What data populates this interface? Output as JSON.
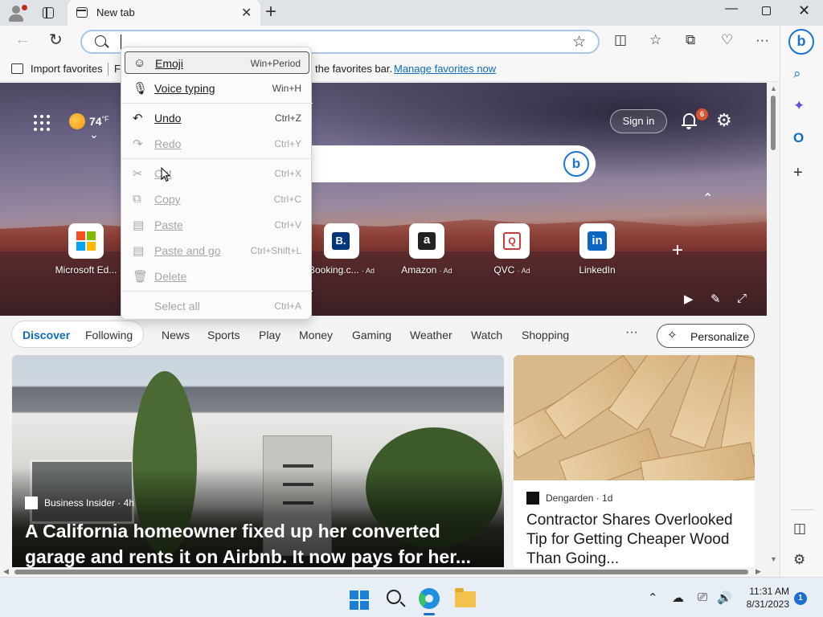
{
  "browser": {
    "tab_title": "New tab",
    "tab_close": "✕",
    "new_tab": "+",
    "window_min": "—",
    "window_close": "✕"
  },
  "toolbar": {
    "back": "←",
    "refresh": "↻",
    "address_value": "",
    "favorite_star": "☆",
    "split": "◫",
    "favorites": "☆",
    "collections": "⧉",
    "extensions": "♡",
    "more": "···"
  },
  "favbar": {
    "import_label": "Import favorites",
    "partial_item": "F",
    "message": "the favorites bar.",
    "manage_link": "Manage favorites now"
  },
  "sidebar": {
    "bing": "b",
    "search": "⌕",
    "copilot": "✦",
    "outlook": "O",
    "add": "+",
    "panel": "◫",
    "settings": "⚙"
  },
  "hero": {
    "temperature": "74",
    "temp_unit": "°F",
    "weather_caret": "⌄",
    "signin_label": "Sign in",
    "notification_count": "6",
    "settings": "⚙",
    "bing": "b",
    "collapse": "⌃",
    "add_tile": "+",
    "play": "▶",
    "edit": "✎",
    "expand": "⤢"
  },
  "tiles": [
    {
      "label": "Microsoft Ed...",
      "ad": ""
    },
    {
      "label": "Booking.c...",
      "ad": "· Ad",
      "glyph": "B."
    },
    {
      "label": "Amazon",
      "ad": "· Ad",
      "glyph": "a"
    },
    {
      "label": "QVC",
      "ad": "· Ad",
      "glyph": "Q"
    },
    {
      "label": "LinkedIn",
      "ad": "",
      "glyph": "in"
    }
  ],
  "feed_nav": {
    "discover": "Discover",
    "following": "Following",
    "items": [
      "News",
      "Sports",
      "Play",
      "Money",
      "Gaming",
      "Weather",
      "Watch",
      "Shopping"
    ],
    "more": "···",
    "personalize": "Personalize"
  },
  "cards": {
    "main": {
      "source": "Business Insider · 4h",
      "headline": "A California homeowner fixed up her converted garage and rents it on Airbnb. It now pays for her..."
    },
    "side": {
      "source": "Dengarden · 1d",
      "headline": "Contractor Shares Overlooked Tip for Getting Cheaper Wood Than Going..."
    }
  },
  "context_menu": {
    "items": [
      {
        "label": "Emoji",
        "shortcut": "Win+Period",
        "icon": "☺"
      },
      {
        "label": "Voice typing",
        "shortcut": "Win+H",
        "icon": "🎙"
      },
      {
        "label": "Undo",
        "shortcut": "Ctrl+Z",
        "icon": "↶"
      },
      {
        "label": "Redo",
        "shortcut": "Ctrl+Y",
        "icon": "↷"
      },
      {
        "label": "Cut",
        "shortcut": "Ctrl+X",
        "icon": "✂"
      },
      {
        "label": "Copy",
        "shortcut": "Ctrl+C",
        "icon": "⧉"
      },
      {
        "label": "Paste",
        "shortcut": "Ctrl+V",
        "icon": "▤"
      },
      {
        "label": "Paste and go",
        "shortcut": "Ctrl+Shift+L",
        "icon": "▤"
      },
      {
        "label": "Delete",
        "shortcut": "",
        "icon": "🗑"
      },
      {
        "label": "Select all",
        "shortcut": "Ctrl+A",
        "icon": ""
      }
    ]
  },
  "taskbar": {
    "clock_time": "11:31 AM",
    "clock_date": "8/31/2023",
    "notification_count": "1",
    "tray_chevron": "⌃",
    "tray_network": "⎚",
    "tray_volume": "🔊"
  },
  "colors": {
    "accent": "#0f6cbd",
    "bing_blue": "#1a74d8",
    "badge_orange": "#d9542f"
  }
}
